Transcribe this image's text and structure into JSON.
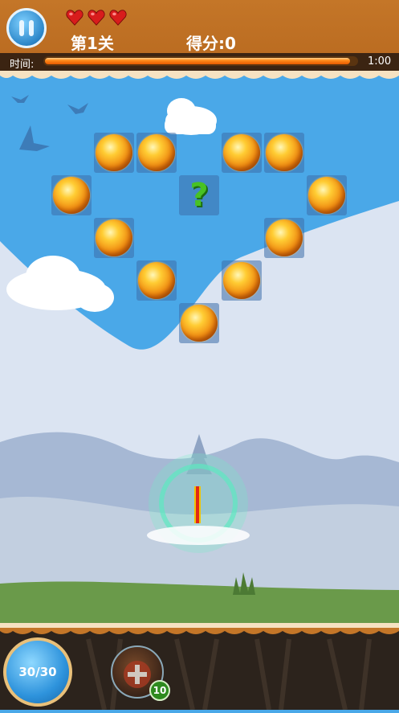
{
  "header": {
    "lives": 3,
    "level_label": "第1关",
    "score_label": "得分:0",
    "time_label": "时间:",
    "time_value": "1:00",
    "time_remaining_fraction": 0.98
  },
  "board": {
    "cells": [
      {
        "row": 0,
        "col": 2,
        "type": "ball"
      },
      {
        "row": 0,
        "col": 3,
        "type": "ball"
      },
      {
        "row": 0,
        "col": 5,
        "type": "ball"
      },
      {
        "row": 0,
        "col": 6,
        "type": "ball"
      },
      {
        "row": 1,
        "col": 1,
        "type": "ball"
      },
      {
        "row": 1,
        "col": 4,
        "type": "question",
        "text": "?"
      },
      {
        "row": 1,
        "col": 7,
        "type": "ball"
      },
      {
        "row": 2,
        "col": 2,
        "type": "ball"
      },
      {
        "row": 2,
        "col": 6,
        "type": "ball"
      },
      {
        "row": 3,
        "col": 3,
        "type": "ball"
      },
      {
        "row": 3,
        "col": 5,
        "type": "ball"
      },
      {
        "row": 4,
        "col": 4,
        "type": "ball"
      }
    ]
  },
  "footer": {
    "shots_label": "30/30",
    "add_ball_count": "10"
  },
  "colors": {
    "sky": "#4aa8e8",
    "topbar": "#c47628",
    "grass": "#6a9a4a",
    "ball": "#f08a10",
    "question": "#48c224"
  }
}
